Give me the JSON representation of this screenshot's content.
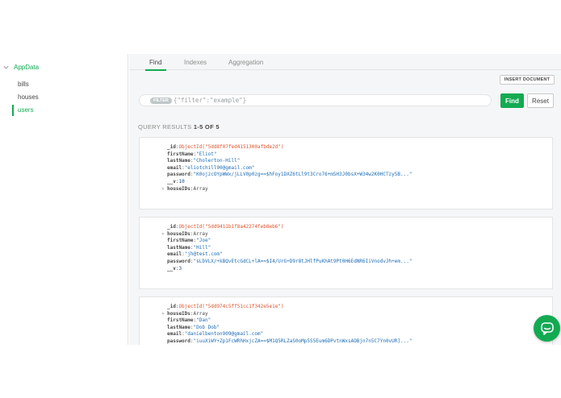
{
  "sidebar": {
    "database": "AppData",
    "collections": [
      {
        "label": "bills",
        "active": false
      },
      {
        "label": "houses",
        "active": false
      },
      {
        "label": "users",
        "active": true
      }
    ]
  },
  "tabs": [
    {
      "label": "Find",
      "active": true
    },
    {
      "label": "Indexes",
      "active": false
    },
    {
      "label": "Aggregation",
      "active": false
    }
  ],
  "toolbar": {
    "insert_label": "INSERT DOCUMENT",
    "filter_tag": "FILTER",
    "filter_placeholder": "{\"filter\":\"example\"}",
    "find_label": "Find",
    "reset_label": "Reset"
  },
  "results": {
    "prefix": "QUERY RESULTS ",
    "range": "1-5 OF 5"
  },
  "documents": [
    {
      "fields": [
        {
          "key": "_id",
          "value": "ObjectId(\"5dd8f07fed4151300afbde2d\")",
          "kind": "oid",
          "expandable": false
        },
        {
          "key": "firstName",
          "value": "\"Eliot\"",
          "kind": "str",
          "expandable": false
        },
        {
          "key": "lastName",
          "value": "\"Cholerton-Hill\"",
          "kind": "str",
          "expandable": false
        },
        {
          "key": "email",
          "value": "\"eliotchill90@gmail.com\"",
          "kind": "str",
          "expandable": false
        },
        {
          "key": "password",
          "value": "\"K0ojzcOYpWWx/jLLV0p0zg==$hFoy1DXZ6tLl9t3Cro76+mSH3J0bsX+W34w2K0HCTzy5B...\"",
          "kind": "str",
          "expandable": false
        },
        {
          "key": "__v",
          "value": "10",
          "kind": "num",
          "expandable": false
        },
        {
          "key": "houseIDs",
          "value": "Array",
          "kind": "plain",
          "expandable": true
        }
      ]
    },
    {
      "fields": [
        {
          "key": "_id",
          "value": "ObjectId(\"5dd9411b1f8a42274feb8eb6\")",
          "kind": "oid",
          "expandable": false
        },
        {
          "key": "houseIDs",
          "value": "Array",
          "kind": "plain",
          "expandable": true
        },
        {
          "key": "firstName",
          "value": "\"Joe\"",
          "kind": "str",
          "expandable": false
        },
        {
          "key": "lastName",
          "value": "\"Hill\"",
          "kind": "str",
          "expandable": false
        },
        {
          "key": "email",
          "value": "\"jh@test.com\"",
          "kind": "str",
          "expandable": false
        },
        {
          "key": "password",
          "value": "\"sLbVLX/+kBQvEtcGdCL+lA==$I4/UrG+D9r8tJHlfPuKhAt9Pt0H6EdNR6IiVnodvJh+em...\"",
          "kind": "str",
          "expandable": false
        },
        {
          "key": "__v",
          "value": "3",
          "kind": "num",
          "expandable": false
        }
      ]
    },
    {
      "fields": [
        {
          "key": "_id",
          "value": "ObjectId(\"5dd974c5ff51cc1f342e5e1e\")",
          "kind": "oid",
          "expandable": false
        },
        {
          "key": "houseIDs",
          "value": "Array",
          "kind": "plain",
          "expandable": true
        },
        {
          "key": "firstName",
          "value": "\"Dan\"",
          "kind": "str",
          "expandable": false
        },
        {
          "key": "lastName",
          "value": "\"Dob Dob\"",
          "kind": "str",
          "expandable": false
        },
        {
          "key": "email",
          "value": "\"danielbenton909@gmail.com\"",
          "kind": "str",
          "expandable": false
        },
        {
          "key": "password",
          "value": "\"iuuXiWY+Zp1FcWRhHxjcZA==$M1Q5RLZaS0oMp5S5Eum6DPvtnWxsAOBjn7n5C7Yn0vUR]...\"",
          "kind": "str",
          "expandable": false
        }
      ]
    }
  ],
  "colors": {
    "accent": "#13aa52",
    "object_id": "#e0532b",
    "string": "#1b6bb5"
  },
  "icons": {
    "collapse": "chevron-down-icon",
    "expand": "caret-right-icon",
    "chat": "chat-bubble-icon"
  }
}
